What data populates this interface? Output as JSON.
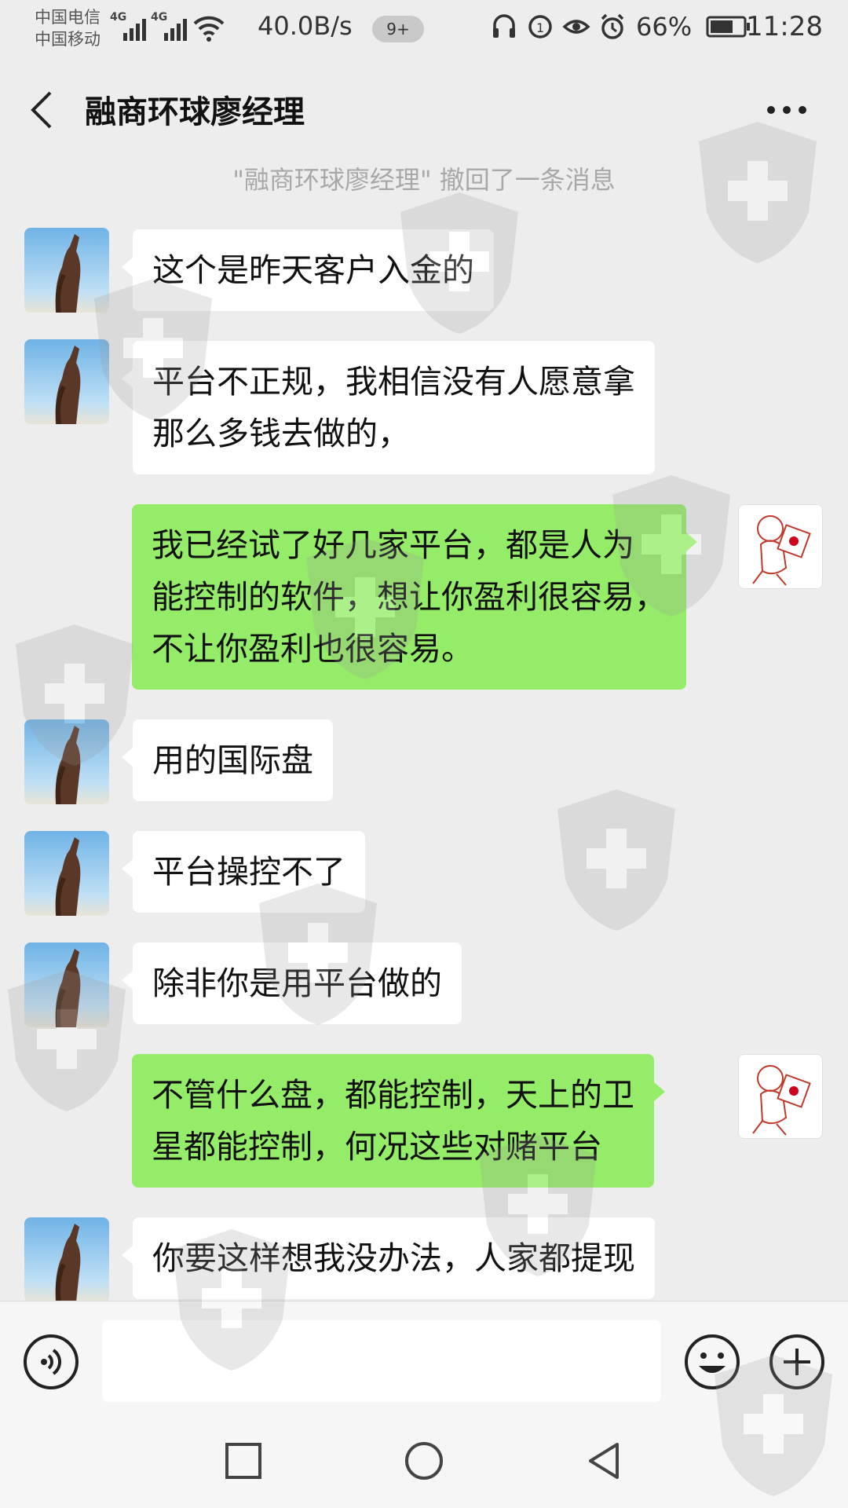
{
  "status_bar": {
    "carrier_1": "中国电信",
    "carrier_2": "中国移动",
    "network_1": "4G",
    "network_2": "4G",
    "net_speed": "40.0B/s",
    "notification_badge": "9+",
    "battery_percent": "66%",
    "time": "11:28"
  },
  "header": {
    "title": "融商环球廖经理"
  },
  "system_notice": "\"融商环球廖经理\" 撤回了一条消息",
  "messages": [
    {
      "side": "left",
      "lines": [
        "这个是昨天客户入金的"
      ]
    },
    {
      "side": "left",
      "lines": [
        "平台不正规，我相信没有人愿意拿",
        "那么多钱去做的，"
      ]
    },
    {
      "side": "right",
      "lines": [
        "我已经试了好几家平台，都是人为",
        "能控制的软件，想让你盈利很容易，",
        "不让你盈利也很容易。"
      ]
    },
    {
      "side": "left",
      "lines": [
        "用的国际盘"
      ]
    },
    {
      "side": "left",
      "lines": [
        "平台操控不了"
      ]
    },
    {
      "side": "left",
      "lines": [
        "除非你是用平台做的"
      ]
    },
    {
      "side": "right",
      "lines": [
        "不管什么盘，都能控制，天上的卫",
        "星都能控制，何况这些对赌平台"
      ]
    },
    {
      "side": "left",
      "lines": [
        "你要这样想我没办法，人家都提现"
      ]
    }
  ],
  "input": {
    "placeholder": "",
    "value": ""
  },
  "colors": {
    "background": "#ededed",
    "bubble_incoming": "#ffffff",
    "bubble_outgoing": "#95ec69"
  },
  "icons": [
    "back-icon",
    "more-icon",
    "voice-icon",
    "emoji-icon",
    "plus-icon",
    "square-nav-icon",
    "circle-nav-icon",
    "triangle-nav-icon"
  ]
}
